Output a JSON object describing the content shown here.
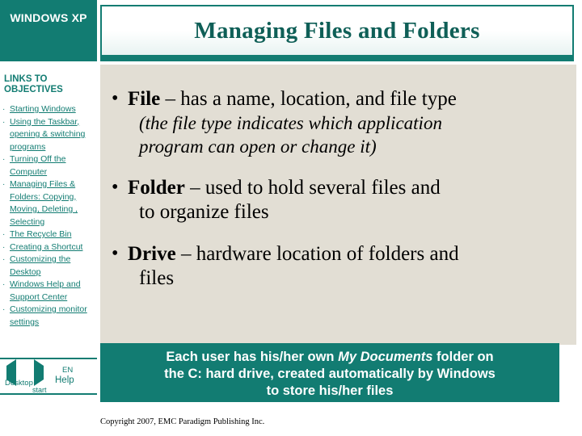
{
  "sidebar": {
    "header_title": "WINDOWS XP",
    "links_heading": "LINKS TO OBJECTIVES",
    "items": [
      {
        "label": "Starting Windows"
      },
      {
        "label": "Using the Taskbar, opening & switching programs"
      },
      {
        "label": "Turning Off the Computer"
      },
      {
        "label": "Managing Files & Folders: Copying, Moving, Deleting , Selecting"
      },
      {
        "label": "The Recycle Bin"
      },
      {
        "label": "Creating a Shortcut"
      },
      {
        "label": "Customizing the Desktop"
      },
      {
        "label": "Windows Help and Support Center"
      },
      {
        "label": "Customizing monitor settings"
      }
    ],
    "nav": {
      "back_icon": "triangle-left-icon",
      "stop_icon": "square-stop-icon",
      "forward_icon": "triangle-right-icon",
      "desktop_label": "Desktop",
      "en_label": "EN",
      "help_label": "Help",
      "start_label": "start"
    }
  },
  "header": {
    "title": "Managing Files and Folders"
  },
  "main": {
    "bullets": [
      {
        "marker": "•",
        "term": "File",
        "text": " – has a name, location, and file type",
        "sub_line1": "(the file type indicates which application",
        "sub_line2": "program can open or change it)"
      },
      {
        "marker": "•",
        "term": "Folder",
        "text": " – used to hold several files and",
        "cont": "to organize files"
      },
      {
        "marker": "•",
        "term": "Drive",
        "text": " – hardware location of folders and",
        "cont": "files"
      }
    ]
  },
  "callout": {
    "line1_pre": "Each user has his/her own ",
    "line1_italic": "My Documents",
    "line1_post": "  folder on",
    "line2": "the C: hard drive, created automatically by Windows",
    "line3": "to store his/her files"
  },
  "footer": {
    "copyright": "Copyright 2007, EMC Paradigm Publishing Inc."
  },
  "colors": {
    "brand_teal": "#127c72",
    "panel_beige": "#e2ded4",
    "title_text": "#0f5f57"
  }
}
